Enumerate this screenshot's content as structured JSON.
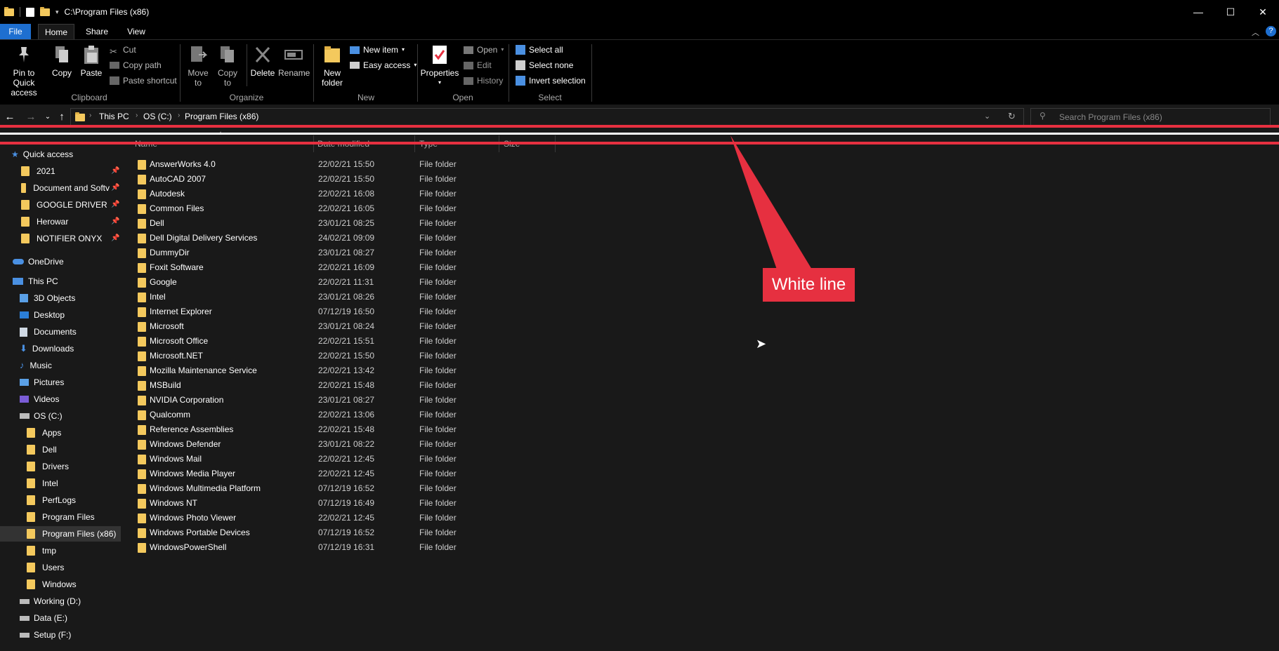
{
  "window": {
    "title": "C:\\Program Files (x86)",
    "controls": {
      "minimize": "—",
      "maximize": "☐",
      "close": "✕"
    }
  },
  "ribbon_tabs": [
    "File",
    "Home",
    "Share",
    "View"
  ],
  "ribbon": {
    "clipboard": {
      "group_label": "Clipboard",
      "pin_label": "Pin to Quick access",
      "copy_label": "Copy",
      "paste_label": "Paste",
      "cut_label": "Cut",
      "copy_path_label": "Copy path",
      "paste_shortcut_label": "Paste shortcut"
    },
    "organize": {
      "group_label": "Organize",
      "move_to_label": "Move to",
      "copy_to_label": "Copy to",
      "delete_label": "Delete",
      "rename_label": "Rename"
    },
    "new": {
      "group_label": "New",
      "new_folder_label": "New folder",
      "new_item_label": "New item",
      "easy_access_label": "Easy access"
    },
    "open": {
      "group_label": "Open",
      "properties_label": "Properties",
      "open_label": "Open",
      "edit_label": "Edit",
      "history_label": "History"
    },
    "select": {
      "group_label": "Select",
      "select_all_label": "Select all",
      "select_none_label": "Select none",
      "invert_selection_label": "Invert selection"
    }
  },
  "address": {
    "breadcrumbs": [
      "This PC",
      "OS (C:)",
      "Program Files (x86)"
    ],
    "search_placeholder": "Search Program Files (x86)"
  },
  "columns": [
    "Name",
    "Date modified",
    "Type",
    "Size"
  ],
  "sidebar": {
    "quick_access": "Quick access",
    "pinned": [
      "2021",
      "Document and Softv",
      "GOOGLE DRIVER",
      "Herowar",
      "NOTIFIER ONYX"
    ],
    "onedrive": "OneDrive",
    "this_pc": "This PC",
    "pc_items": [
      "3D Objects",
      "Desktop",
      "Documents",
      "Downloads",
      "Music",
      "Pictures",
      "Videos",
      "OS (C:)"
    ],
    "c_items": [
      "Apps",
      "Dell",
      "Drivers",
      "Intel",
      "PerfLogs",
      "Program Files",
      "Program Files (x86)",
      "tmp",
      "Users",
      "Windows"
    ],
    "drives": [
      "Working (D:)",
      "Data (E:)",
      "Setup (F:)"
    ]
  },
  "files": [
    {
      "name": "AnswerWorks 4.0",
      "date": "22/02/21 15:50",
      "type": "File folder"
    },
    {
      "name": "AutoCAD 2007",
      "date": "22/02/21 15:50",
      "type": "File folder"
    },
    {
      "name": "Autodesk",
      "date": "22/02/21 16:08",
      "type": "File folder"
    },
    {
      "name": "Common Files",
      "date": "22/02/21 16:05",
      "type": "File folder"
    },
    {
      "name": "Dell",
      "date": "23/01/21 08:25",
      "type": "File folder"
    },
    {
      "name": "Dell Digital Delivery Services",
      "date": "24/02/21 09:09",
      "type": "File folder"
    },
    {
      "name": "DummyDir",
      "date": "23/01/21 08:27",
      "type": "File folder"
    },
    {
      "name": "Foxit Software",
      "date": "22/02/21 16:09",
      "type": "File folder"
    },
    {
      "name": "Google",
      "date": "22/02/21 11:31",
      "type": "File folder"
    },
    {
      "name": "Intel",
      "date": "23/01/21 08:26",
      "type": "File folder"
    },
    {
      "name": "Internet Explorer",
      "date": "07/12/19 16:50",
      "type": "File folder"
    },
    {
      "name": "Microsoft",
      "date": "23/01/21 08:24",
      "type": "File folder"
    },
    {
      "name": "Microsoft Office",
      "date": "22/02/21 15:51",
      "type": "File folder"
    },
    {
      "name": "Microsoft.NET",
      "date": "22/02/21 15:50",
      "type": "File folder"
    },
    {
      "name": "Mozilla Maintenance Service",
      "date": "22/02/21 13:42",
      "type": "File folder"
    },
    {
      "name": "MSBuild",
      "date": "22/02/21 15:48",
      "type": "File folder"
    },
    {
      "name": "NVIDIA Corporation",
      "date": "23/01/21 08:27",
      "type": "File folder"
    },
    {
      "name": "Qualcomm",
      "date": "22/02/21 13:06",
      "type": "File folder"
    },
    {
      "name": "Reference Assemblies",
      "date": "22/02/21 15:48",
      "type": "File folder"
    },
    {
      "name": "Windows Defender",
      "date": "23/01/21 08:22",
      "type": "File folder"
    },
    {
      "name": "Windows Mail",
      "date": "22/02/21 12:45",
      "type": "File folder"
    },
    {
      "name": "Windows Media Player",
      "date": "22/02/21 12:45",
      "type": "File folder"
    },
    {
      "name": "Windows Multimedia Platform",
      "date": "07/12/19 16:52",
      "type": "File folder"
    },
    {
      "name": "Windows NT",
      "date": "07/12/19 16:49",
      "type": "File folder"
    },
    {
      "name": "Windows Photo Viewer",
      "date": "22/02/21 12:45",
      "type": "File folder"
    },
    {
      "name": "Windows Portable Devices",
      "date": "07/12/19 16:52",
      "type": "File folder"
    },
    {
      "name": "WindowsPowerShell",
      "date": "07/12/19 16:31",
      "type": "File folder"
    }
  ],
  "annotation": {
    "label": "White line",
    "color": "#e63040"
  },
  "colors": {
    "accent": "#1e6fd0",
    "folder": "#f4c95d",
    "background": "#191919"
  }
}
